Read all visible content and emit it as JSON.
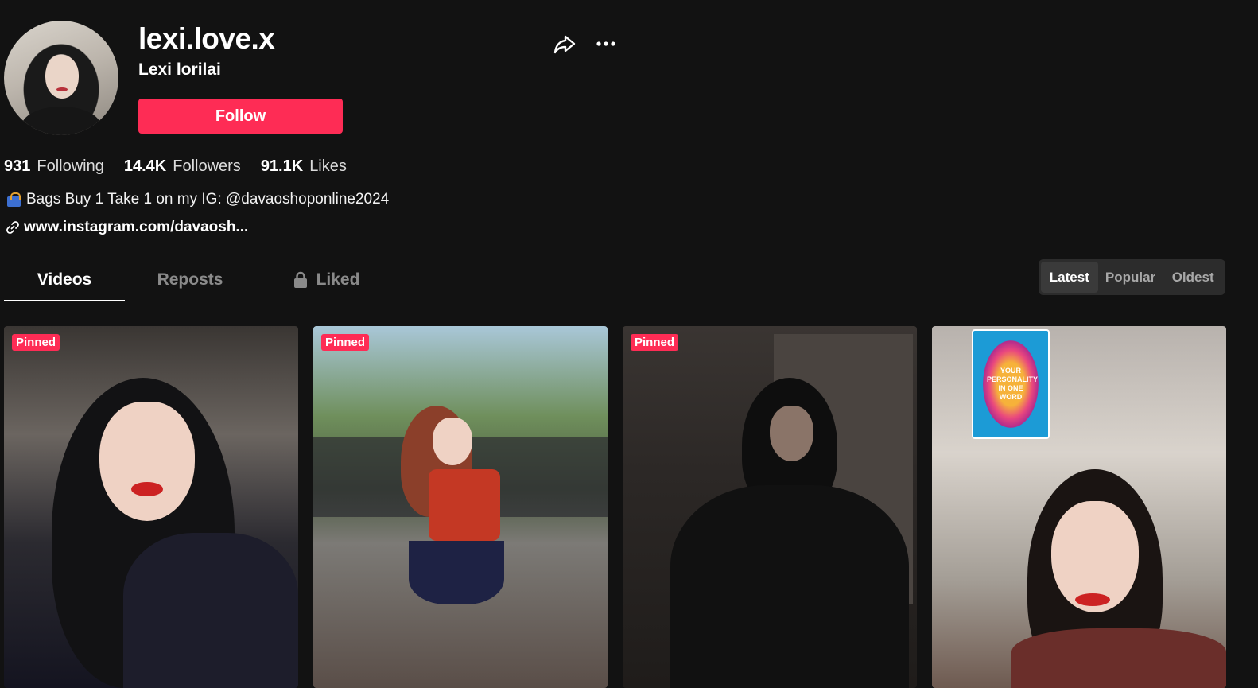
{
  "profile": {
    "username": "lexi.love.x",
    "nickname": "Lexi lorilai",
    "follow_label": "Follow",
    "bio": "Bags Buy 1 Take 1 on my IG: @davaoshoponline2024",
    "link": "www.instagram.com/davaosh..."
  },
  "stats": {
    "following": {
      "value": "931",
      "label": "Following"
    },
    "followers": {
      "value": "14.4K",
      "label": "Followers"
    },
    "likes": {
      "value": "91.1K",
      "label": "Likes"
    }
  },
  "tabs": [
    {
      "label": "Videos",
      "active": true
    },
    {
      "label": "Reposts",
      "active": false
    },
    {
      "label": "Liked",
      "active": false,
      "icon": "lock-icon"
    }
  ],
  "sort": [
    {
      "label": "Latest",
      "active": true
    },
    {
      "label": "Popular",
      "active": false
    },
    {
      "label": "Oldest",
      "active": false
    }
  ],
  "videos": [
    {
      "badge": "Pinned"
    },
    {
      "badge": "Pinned"
    },
    {
      "badge": "Pinned"
    },
    {
      "badge": "",
      "sticker_text": "YOUR PERSONALITY IN ONE WORD"
    }
  ],
  "colors": {
    "background": "#121212",
    "accent": "#fe2c55"
  }
}
